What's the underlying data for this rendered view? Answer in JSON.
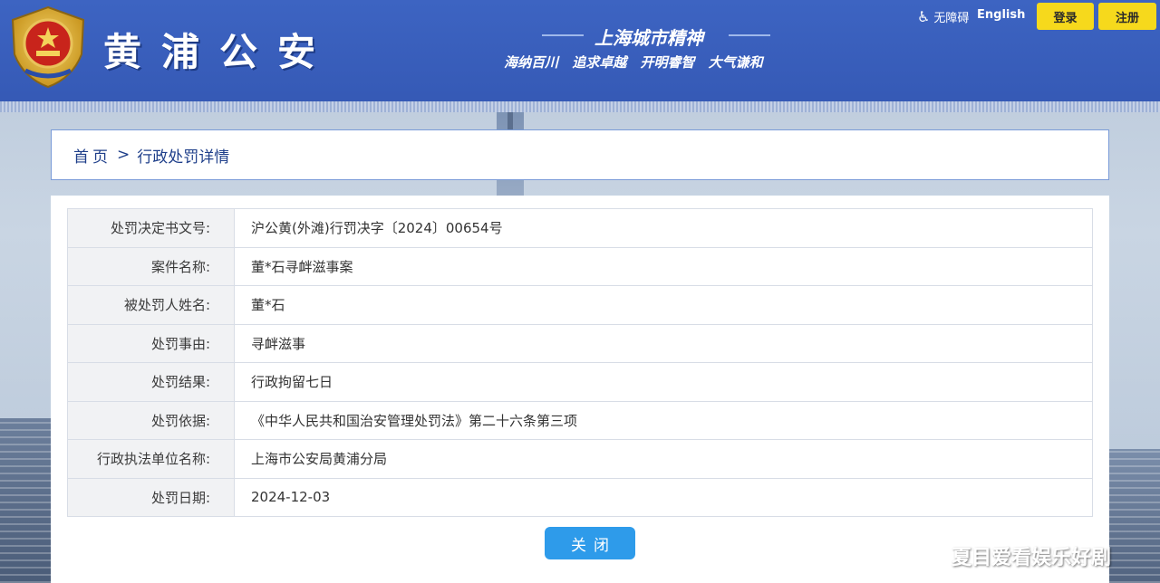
{
  "header": {
    "site_title": "黄浦公安",
    "slogan_title": "上海城市精神",
    "slogan_sub": "海纳百川 追求卓越 开明睿智 大气谦和",
    "accessibility_label": "无障碍",
    "language_label": "English",
    "login_label": "登录",
    "register_label": "注册"
  },
  "breadcrumb": {
    "home": "首页",
    "separator": ">",
    "current": "行政处罚详情"
  },
  "detail": {
    "rows": [
      {
        "label": "处罚决定书文号:",
        "value": "沪公黄(外滩)行罚决字〔2024〕00654号"
      },
      {
        "label": "案件名称:",
        "value": "董*石寻衅滋事案"
      },
      {
        "label": "被处罚人姓名:",
        "value": "董*石"
      },
      {
        "label": "处罚事由:",
        "value": "寻衅滋事"
      },
      {
        "label": "处罚结果:",
        "value": "行政拘留七日"
      },
      {
        "label": "处罚依据:",
        "value": "《中华人民共和国治安管理处罚法》第二十六条第三项"
      },
      {
        "label": "行政执法单位名称:",
        "value": "上海市公安局黄浦分局"
      },
      {
        "label": "处罚日期:",
        "value": "2024-12-03"
      }
    ],
    "close_label": "关闭"
  },
  "watermark": "夏目爱看娱乐好剧",
  "colors": {
    "header_blue": "#3559b5",
    "button_yellow": "#f6d91c",
    "close_button_blue": "#2e9bea",
    "breadcrumb_border": "#7a9bd8"
  },
  "icons": {
    "emblem": "police-emblem-icon",
    "accessibility": "wheelchair-icon"
  }
}
